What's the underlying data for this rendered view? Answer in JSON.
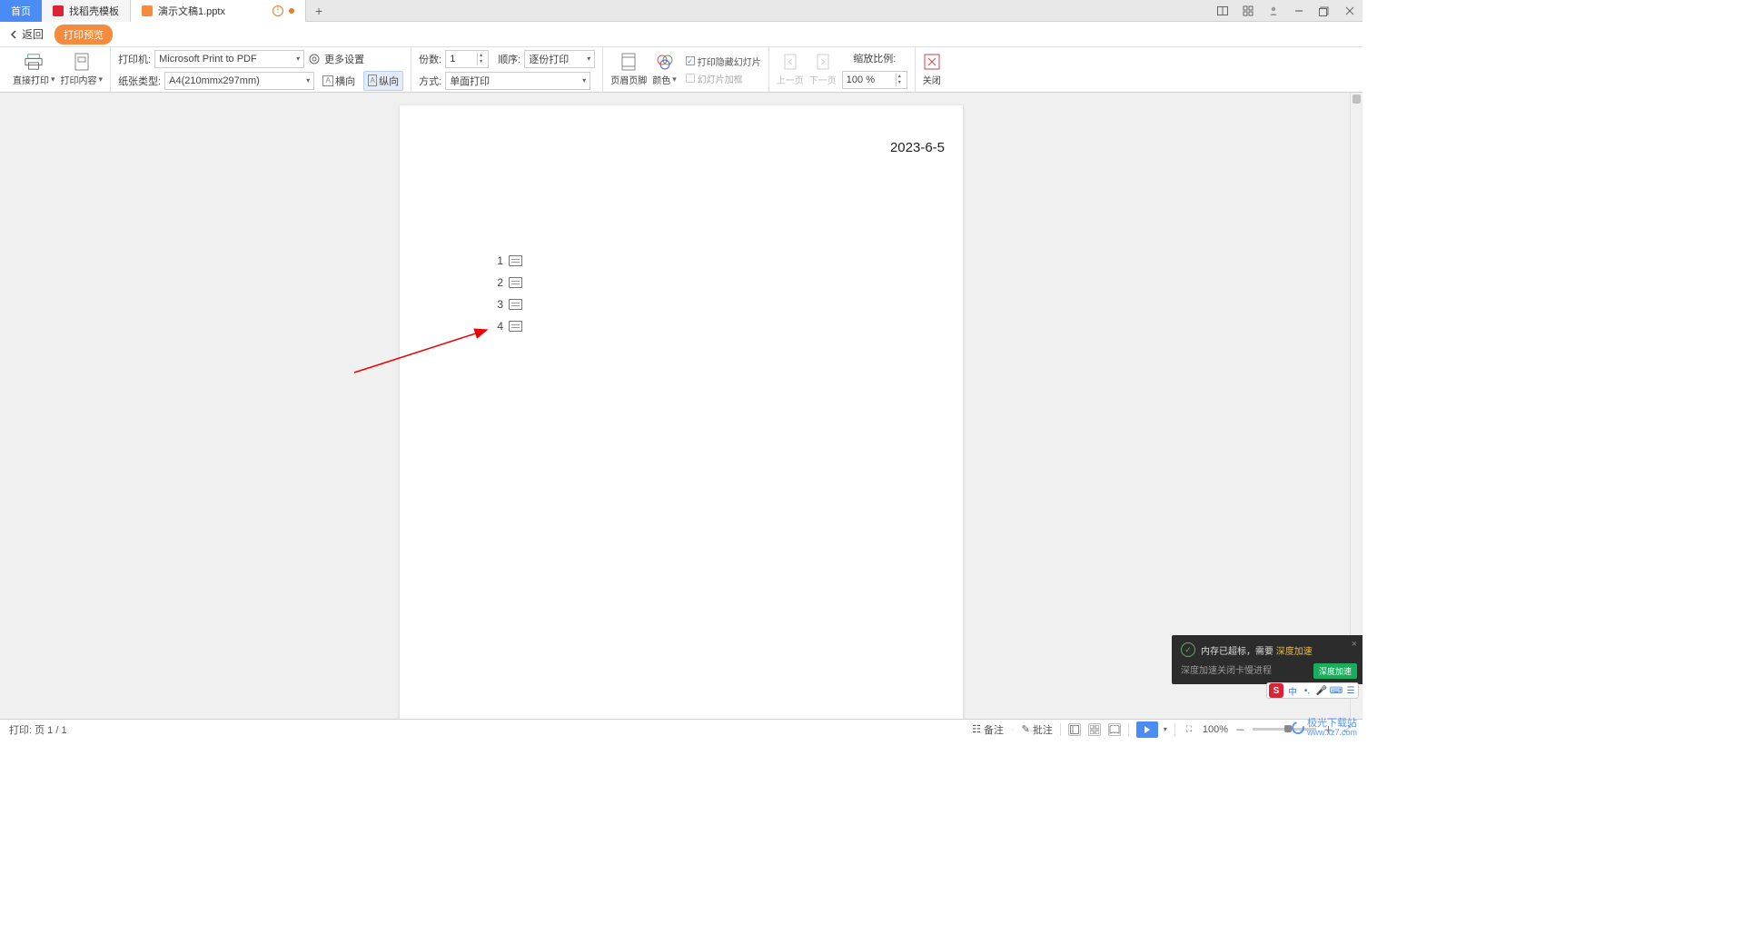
{
  "tabs": {
    "home": "首页",
    "templates": "找稻壳模板",
    "current": "演示文稿1.pptx"
  },
  "subbar": {
    "back": "返回",
    "preview_badge": "打印预览"
  },
  "ribbon": {
    "direct_print": "直接打印",
    "print_content": "打印内容",
    "printer_label": "打印机:",
    "printer_value": "Microsoft Print to PDF",
    "paper_label": "纸张类型:",
    "paper_value": "A4(210mmx297mm)",
    "more_settings": "更多设置",
    "landscape": "横向",
    "portrait": "纵向",
    "copies_label": "份数:",
    "copies_value": "1",
    "order_label": "顺序:",
    "order_value": "逐份打印",
    "mode_label": "方式:",
    "mode_value": "单面打印",
    "header_footer": "页眉页脚",
    "color": "颜色",
    "hide_slides": "打印隐藏幻灯片",
    "slide_frame": "幻灯片加框",
    "prev_page": "上一页",
    "next_page": "下一页",
    "zoom_label": "缩放比例:",
    "zoom_value": "100 %",
    "close": "关闭"
  },
  "page": {
    "date": "2023-6-5",
    "outline": [
      "1",
      "2",
      "3",
      "4"
    ]
  },
  "statusbar": {
    "page_info": "打印: 页 1 / 1",
    "notes": "备注",
    "comments": "批注",
    "zoom": "100%"
  },
  "notif": {
    "title_prefix": "内存已超标，需要 ",
    "title_accent": "深度加速",
    "subtitle": "深度加速关闭卡慢进程",
    "btn": "深度加速"
  },
  "ime": {
    "s": "S",
    "lang": "中"
  },
  "watermark": {
    "name": "极光下载站",
    "url": "www.xz7.com"
  }
}
